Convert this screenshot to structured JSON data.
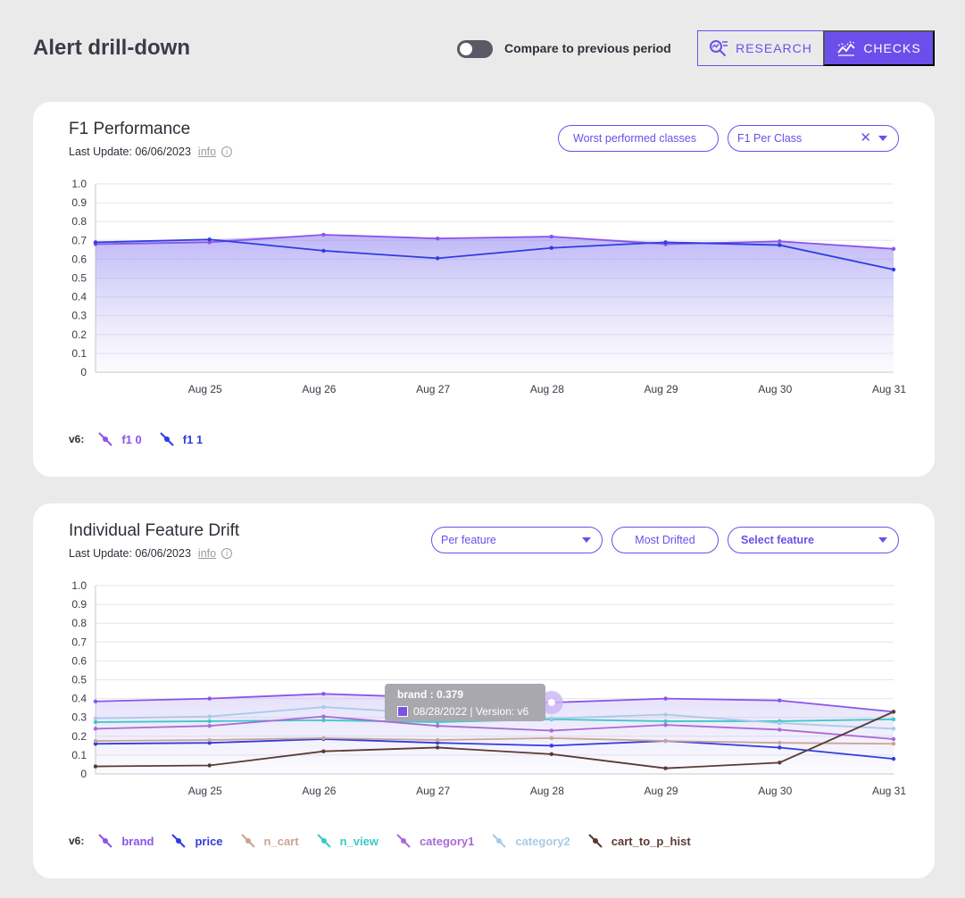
{
  "header": {
    "title": "Alert drill-down",
    "compare_label": "Compare to previous period",
    "research_label": "RESEARCH",
    "checks_label": "CHECKS"
  },
  "card1": {
    "title": "F1 Performance",
    "last_update": "Last Update: 06/06/2023",
    "info": "info",
    "worst_classes": "Worst performed classes",
    "metric_select": "F1 Per Class",
    "version_label": "v6:"
  },
  "card2": {
    "title": "Individual Feature Drift",
    "last_update": "Last Update: 06/06/2023",
    "info": "info",
    "per_feature": "Per feature",
    "most_drifted": "Most Drifted",
    "select_feature": "Select feature",
    "version_label": "v6:"
  },
  "tooltip": {
    "title": "brand : 0.379",
    "detail": "08/28/2022 | Version: v6"
  },
  "chart_data": [
    {
      "type": "area",
      "title": "F1 Performance",
      "categories": [
        "",
        "Aug 25",
        "Aug 26",
        "Aug 27",
        "Aug 28",
        "Aug 29",
        "Aug 30",
        "Aug 31"
      ],
      "ylim": [
        0,
        1.0
      ],
      "yticks": [
        "0",
        "0.1",
        "0.2",
        "0.3",
        "0.4",
        "0.5",
        "0.6",
        "0.7",
        "0.8",
        "0.9",
        "1.0"
      ],
      "grid": true,
      "legend": "bottom-left",
      "series": [
        {
          "name": "f1 0",
          "color": "#8b55e8",
          "values": [
            0.68,
            0.69,
            0.73,
            0.71,
            0.72,
            0.68,
            0.695,
            0.655
          ]
        },
        {
          "name": "f1 1",
          "color": "#2f3de0",
          "values": [
            0.69,
            0.705,
            0.645,
            0.605,
            0.66,
            0.69,
            0.675,
            0.545
          ]
        }
      ]
    },
    {
      "type": "line",
      "title": "Individual Feature Drift",
      "categories": [
        "",
        "Aug 25",
        "Aug 26",
        "Aug 27",
        "Aug 28",
        "Aug 29",
        "Aug 30",
        "Aug 31"
      ],
      "ylim": [
        0,
        1.0
      ],
      "yticks": [
        "0",
        "0.1",
        "0.2",
        "0.3",
        "0.4",
        "0.5",
        "0.6",
        "0.7",
        "0.8",
        "0.9",
        "1.0"
      ],
      "grid": true,
      "legend": "bottom-left",
      "series": [
        {
          "name": "brand",
          "color": "#8b55e8",
          "values": [
            0.385,
            0.4,
            0.425,
            0.405,
            0.379,
            0.4,
            0.39,
            0.33
          ]
        },
        {
          "name": "price",
          "color": "#2f3de0",
          "values": [
            0.16,
            0.165,
            0.185,
            0.165,
            0.15,
            0.175,
            0.14,
            0.08
          ]
        },
        {
          "name": "n_cart",
          "color": "#c9a595",
          "values": [
            0.175,
            0.18,
            0.19,
            0.18,
            0.19,
            0.175,
            0.165,
            0.16
          ]
        },
        {
          "name": "n_view",
          "color": "#3cc9c6",
          "values": [
            0.275,
            0.28,
            0.285,
            0.275,
            0.29,
            0.28,
            0.28,
            0.29
          ]
        },
        {
          "name": "category1",
          "color": "#a86ad8",
          "values": [
            0.24,
            0.255,
            0.305,
            0.255,
            0.23,
            0.26,
            0.235,
            0.185
          ]
        },
        {
          "name": "category2",
          "color": "#a8cbe6",
          "values": [
            0.295,
            0.305,
            0.355,
            0.32,
            0.295,
            0.315,
            0.27,
            0.24
          ]
        },
        {
          "name": "cart_to_p_hist",
          "color": "#5b3a34",
          "values": [
            0.04,
            0.045,
            0.12,
            0.14,
            0.105,
            0.03,
            0.06,
            0.33
          ]
        }
      ]
    }
  ]
}
